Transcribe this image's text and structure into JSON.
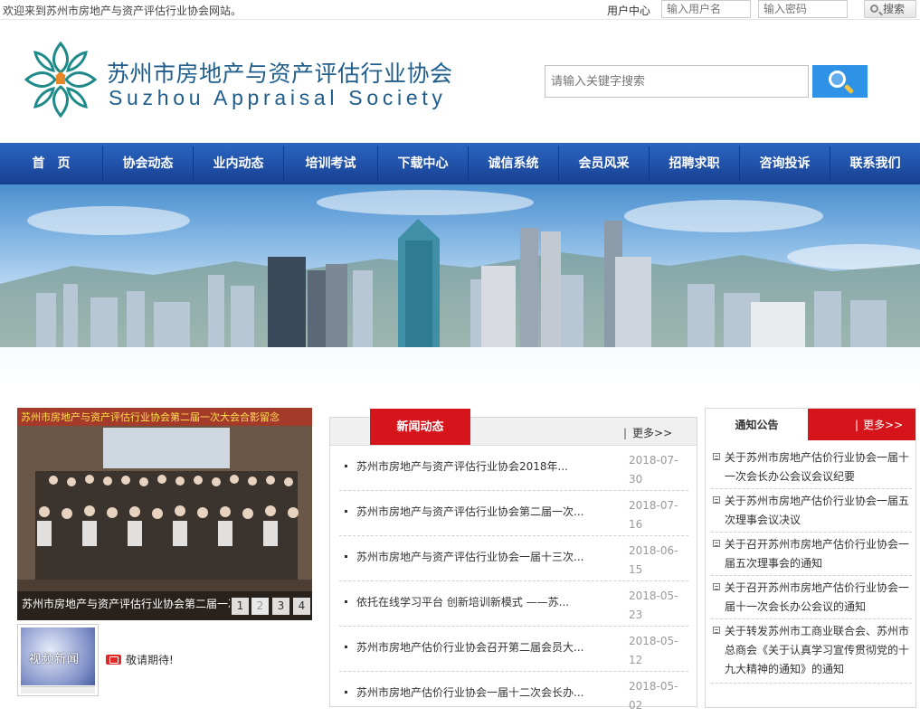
{
  "topbar": {
    "welcome": "欢迎来到苏州市房地产与资产评估行业协会网站。",
    "user_center": "用户中心",
    "username_placeholder": "输入用户名",
    "password_placeholder": "输入密码",
    "search_label": "搜索"
  },
  "header": {
    "title": "苏州市房地产与资产评估行业协会",
    "subtitle": "Suzhou Appraisal Society",
    "search_placeholder": "请输入关键字搜索"
  },
  "nav": {
    "items": [
      "首　页",
      "协会动态",
      "业内动态",
      "培训考试",
      "下载中心",
      "诚信系统",
      "会员风采",
      "招聘求职",
      "咨询投诉",
      "联系我们"
    ]
  },
  "slider": {
    "photo_banner": "苏州市房地产与资产评估行业协会第二届一次大会合影留念",
    "caption": "苏州市房地产与资产评估行业协会第二届一次会员大会召开",
    "pages": [
      "1",
      "2",
      "3",
      "4"
    ],
    "active_page": 2
  },
  "video": {
    "label": "视频新闻",
    "expect": "敬请期待!"
  },
  "news": {
    "tab": "新闻动态",
    "more": "更多>>",
    "items": [
      {
        "title": "苏州市房地产与资产评估行业协会2018年...",
        "date": "2018-07-30"
      },
      {
        "title": "苏州市房地产与资产评估行业协会第二届一次...",
        "date": "2018-07-16"
      },
      {
        "title": "苏州市房地产与资产评估行业协会一届十三次...",
        "date": "2018-06-15"
      },
      {
        "title": "依托在线学习平台 创新培训新模式 ——苏...",
        "date": "2018-05-23"
      },
      {
        "title": "苏州市房地产估价行业协会召开第二届会员大...",
        "date": "2018-05-12"
      },
      {
        "title": "苏州市房地产估价行业协会一届十二次会长办...",
        "date": "2018-05-02"
      }
    ]
  },
  "notice": {
    "title": "通知公告",
    "more": "更多>>",
    "items": [
      "关于苏州市房地产估价行业协会一届十一次会长办公会议会议纪要",
      "关于苏州市房地产估价行业协会一届五次理事会议决议",
      "关于召开苏州市房地产估价行业协会一届五次理事会的通知",
      "关于召开苏州市房地产估价行业协会一届十一次会长办公会议的通知",
      "关于转发苏州市工商业联合会、苏州市总商会《关于认真学习宣传贯彻党的十九大精神的通知》的通知"
    ]
  },
  "colors": {
    "nav_blue": "#1f4fa6",
    "accent_red": "#d5141b",
    "title_blue": "#1e5d8c",
    "search_blue": "#2e93e6",
    "logo_teal": "#1f8a8a"
  }
}
